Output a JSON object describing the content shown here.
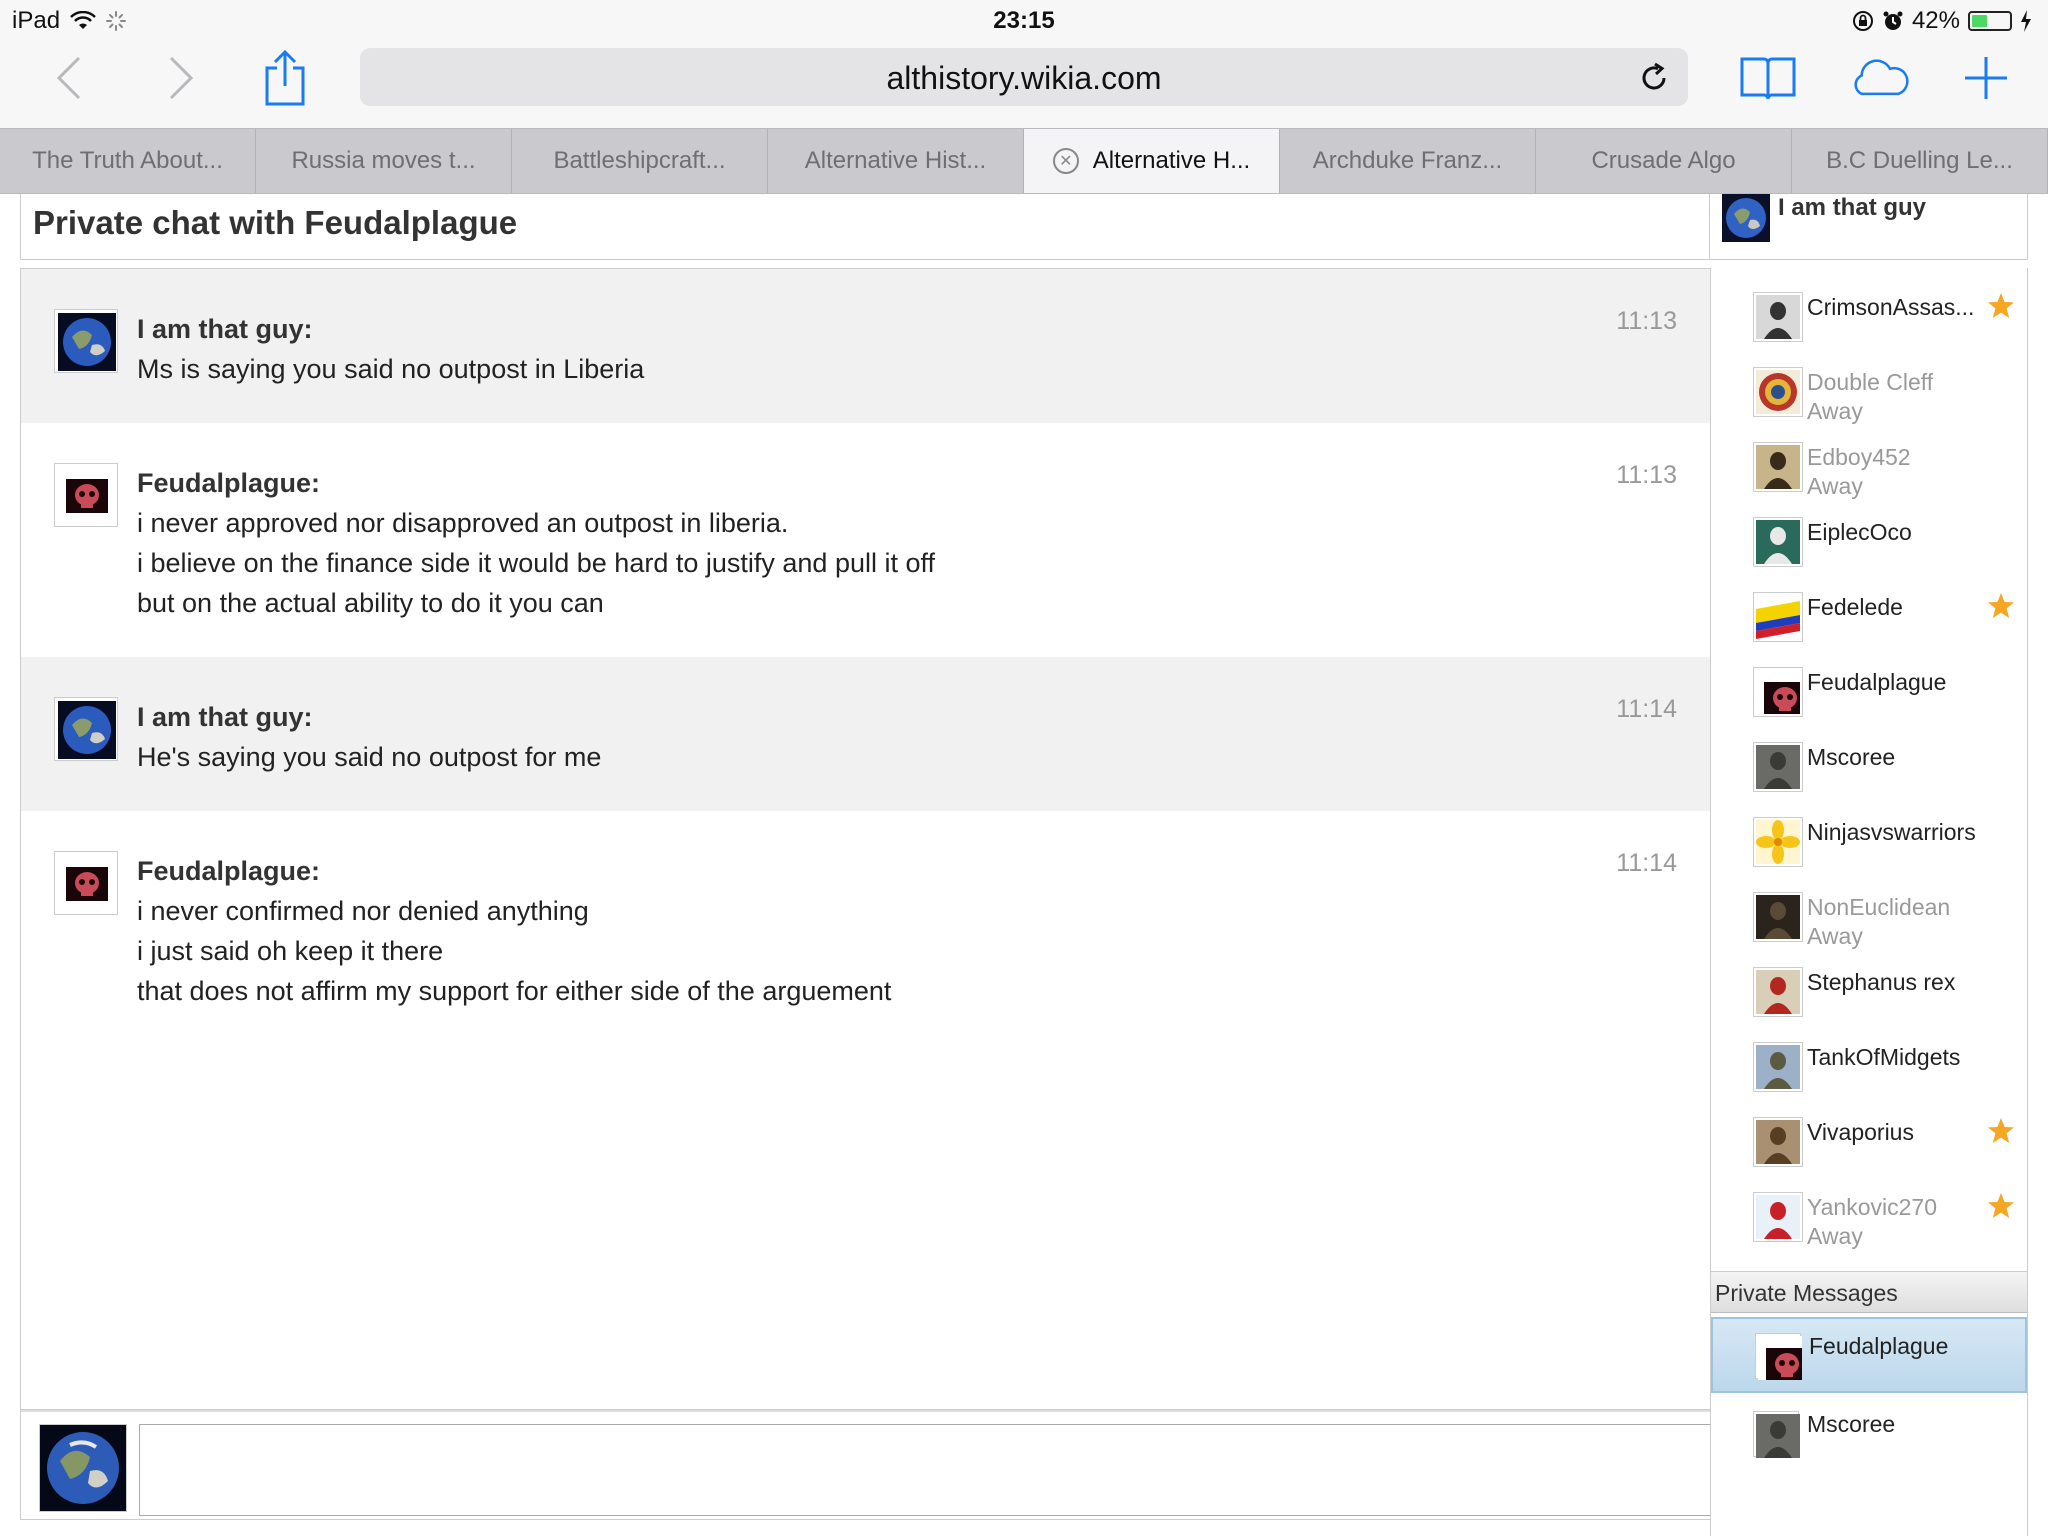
{
  "status_bar": {
    "device": "iPad",
    "time": "23:15",
    "battery": "42%",
    "battery_level": 0.42
  },
  "browser": {
    "url": "althistory.wikia.com",
    "tabs": [
      {
        "label": "The Truth About..."
      },
      {
        "label": "Russia moves t..."
      },
      {
        "label": "Battleshipcraft..."
      },
      {
        "label": "Alternative Hist..."
      },
      {
        "label": "Alternative H..."
      },
      {
        "label": "Archduke Franz..."
      },
      {
        "label": "Crusade Algo"
      },
      {
        "label": "B.C Duelling Le..."
      }
    ]
  },
  "chat": {
    "title": "Private chat with Feudalplague",
    "current_user": "I am that guy",
    "messages": [
      {
        "user": "I am that guy:",
        "time": "11:13",
        "lines": [
          "Ms is saying you said no outpost in Liberia"
        ]
      },
      {
        "user": "Feudalplague:",
        "time": "11:13",
        "lines": [
          "i never approved nor disapproved an outpost in liberia.",
          "i believe on the finance side it would be hard to justify and pull it off",
          "but on the actual ability to do it you can"
        ]
      },
      {
        "user": "I am that guy:",
        "time": "11:14",
        "lines": [
          "He's saying you said no outpost for me"
        ]
      },
      {
        "user": "Feudalplague:",
        "time": "11:14",
        "lines": [
          "i never confirmed nor denied anything",
          "i just said oh keep it there",
          "that does not affirm my support for either side of the arguement"
        ]
      }
    ]
  },
  "users": [
    {
      "name": "CrimsonAssas...",
      "status": "",
      "star": true
    },
    {
      "name": "Double Cleff",
      "status": "Away",
      "star": false
    },
    {
      "name": "Edboy452",
      "status": "Away",
      "star": false
    },
    {
      "name": "EiplecOco",
      "status": "",
      "star": false
    },
    {
      "name": "Fedelede",
      "status": "",
      "star": true
    },
    {
      "name": "Feudalplague",
      "status": "",
      "star": false
    },
    {
      "name": "Mscoree",
      "status": "",
      "star": false
    },
    {
      "name": "Ninjasvswarriors",
      "status": "",
      "star": false
    },
    {
      "name": "NonEuclidean",
      "status": "Away",
      "star": false
    },
    {
      "name": "Stephanus rex",
      "status": "",
      "star": false
    },
    {
      "name": "TankOfMidgets",
      "status": "",
      "star": false
    },
    {
      "name": "Vivaporius",
      "status": "",
      "star": true
    },
    {
      "name": "Yankovic270",
      "status": "Away",
      "star": true
    }
  ],
  "private_messages": {
    "header": "Private Messages",
    "items": [
      {
        "name": "Feudalplague",
        "active": true
      },
      {
        "name": "Mscoree",
        "active": false
      }
    ]
  },
  "colors": {
    "accent": "#1a7bf2",
    "star": "#f5a623",
    "away_text": "#999999"
  }
}
